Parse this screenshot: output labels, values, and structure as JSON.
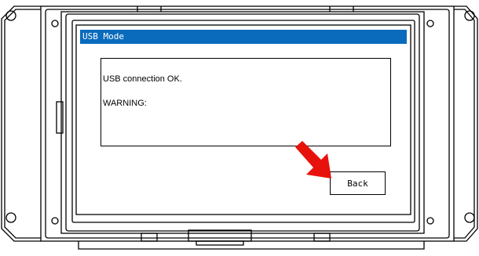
{
  "window": {
    "title": "USB Mode"
  },
  "message": {
    "line1": "USB connection OK.",
    "line2": "WARNING:"
  },
  "buttons": {
    "back_label": "Back"
  },
  "colors": {
    "titlebar": "#0a6bbd",
    "arrow": "#e8120c"
  }
}
